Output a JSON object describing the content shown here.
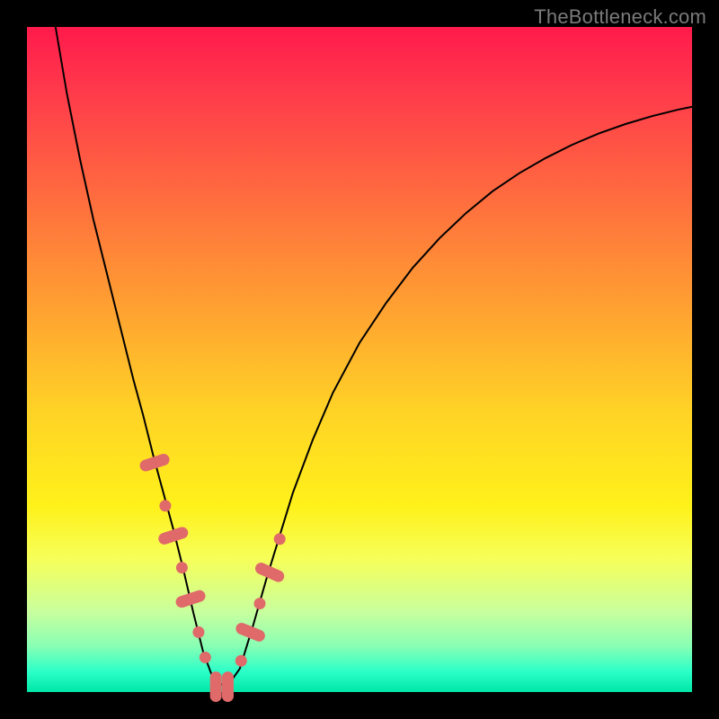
{
  "watermark": "TheBottleneck.com",
  "colors": {
    "frame": "#000000",
    "gradient_top": "#ff1a4b",
    "gradient_bottom": "#00e6a6",
    "curve": "#000000",
    "markers": "#e06a6a"
  },
  "chart_data": {
    "type": "line",
    "title": "",
    "xlabel": "",
    "ylabel": "",
    "xlim": [
      0,
      100
    ],
    "ylim": [
      0,
      100
    ],
    "x": [
      4.3,
      6.0,
      8.0,
      10.0,
      12.0,
      14.0,
      16.0,
      17.5,
      19.0,
      20.5,
      22.0,
      23.5,
      25.0,
      26.5,
      28.0,
      30.0,
      32.0,
      34.0,
      36.0,
      38.0,
      40.0,
      43.0,
      46.0,
      50.0,
      54.0,
      58.0,
      62.0,
      66.0,
      70.0,
      74.0,
      78.0,
      82.0,
      86.0,
      90.0,
      94.0,
      98.0,
      100.0
    ],
    "values": [
      100.0,
      90.0,
      80.0,
      71.0,
      63.0,
      55.0,
      47.0,
      41.5,
      35.5,
      30.0,
      24.5,
      18.5,
      12.0,
      6.0,
      2.0,
      0.7,
      3.5,
      10.0,
      17.0,
      23.5,
      30.0,
      38.0,
      45.0,
      52.5,
      58.5,
      63.8,
      68.2,
      72.0,
      75.3,
      78.0,
      80.3,
      82.3,
      84.0,
      85.4,
      86.6,
      87.6,
      88.0
    ],
    "markers": {
      "pills": [
        {
          "x": 19.2,
          "y": 34.5,
          "angle": 72
        },
        {
          "x": 22.0,
          "y": 23.5,
          "angle": 72
        },
        {
          "x": 24.6,
          "y": 14.0,
          "angle": 72
        },
        {
          "x": 33.6,
          "y": 9.0,
          "angle": -68
        },
        {
          "x": 36.5,
          "y": 18.0,
          "angle": -66
        },
        {
          "x": 28.4,
          "y": 0.8,
          "angle": 0
        },
        {
          "x": 30.2,
          "y": 0.8,
          "angle": 0
        }
      ],
      "dots": [
        {
          "x": 20.8,
          "y": 28.0
        },
        {
          "x": 23.3,
          "y": 18.7
        },
        {
          "x": 25.8,
          "y": 9.0
        },
        {
          "x": 26.8,
          "y": 5.2
        },
        {
          "x": 32.2,
          "y": 4.7
        },
        {
          "x": 35.0,
          "y": 13.3
        },
        {
          "x": 38.0,
          "y": 23.0
        }
      ]
    }
  }
}
